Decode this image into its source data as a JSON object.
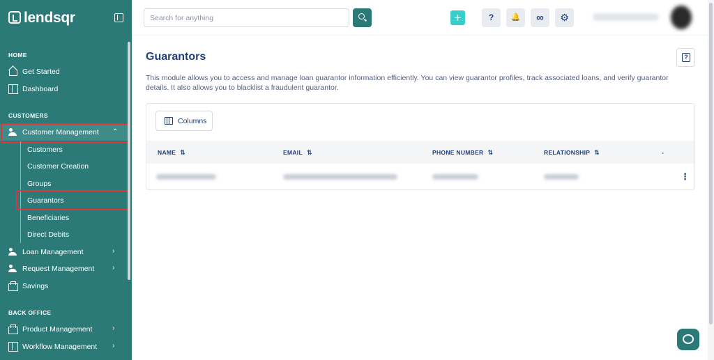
{
  "brand": {
    "name": "lendsqr"
  },
  "sidebar": {
    "sections": {
      "home": "HOME",
      "customers": "CUSTOMERS",
      "back_office": "BACK OFFICE"
    },
    "items": {
      "get_started": "Get Started",
      "dashboard": "Dashboard",
      "customer_management": "Customer Management",
      "customers": "Customers",
      "customer_creation": "Customer Creation",
      "groups": "Groups",
      "guarantors": "Guarantors",
      "beneficiaries": "Beneficiaries",
      "direct_debits": "Direct Debits",
      "loan_management": "Loan Management",
      "request_management": "Request Management",
      "savings": "Savings",
      "product_management": "Product Management",
      "workflow_management": "Workflow Management"
    },
    "chevrons": {
      "up": "⌃",
      "right": "›"
    }
  },
  "topbar": {
    "search_placeholder": "Search for anything",
    "plus": "+",
    "icons": [
      "help-icon",
      "bell-icon",
      "link-icon",
      "gear-icon"
    ],
    "glyphs": {
      "help": "?",
      "bell": "🔔",
      "link": "∞",
      "gear": "⚙"
    }
  },
  "main": {
    "title": "Guarantors",
    "help_glyph": "?",
    "description": "This module allows you to access and manage loan guarantor information efficiently. You can view guarantor profiles, track associated loans, and verify guarantor details. It also allows you to blacklist a fraudulent guarantor.",
    "columns_button": "Columns",
    "table": {
      "headers": [
        "NAME",
        "EMAIL",
        "PHONE NUMBER",
        "RELATIONSHIP",
        "-"
      ],
      "sort_glyph": "⇅",
      "row_action": "⋮"
    }
  },
  "colors": {
    "sidebar": "#2b7a78",
    "accent": "#39cdcc",
    "text_primary": "#213f7d",
    "highlight": "#e0353a"
  }
}
